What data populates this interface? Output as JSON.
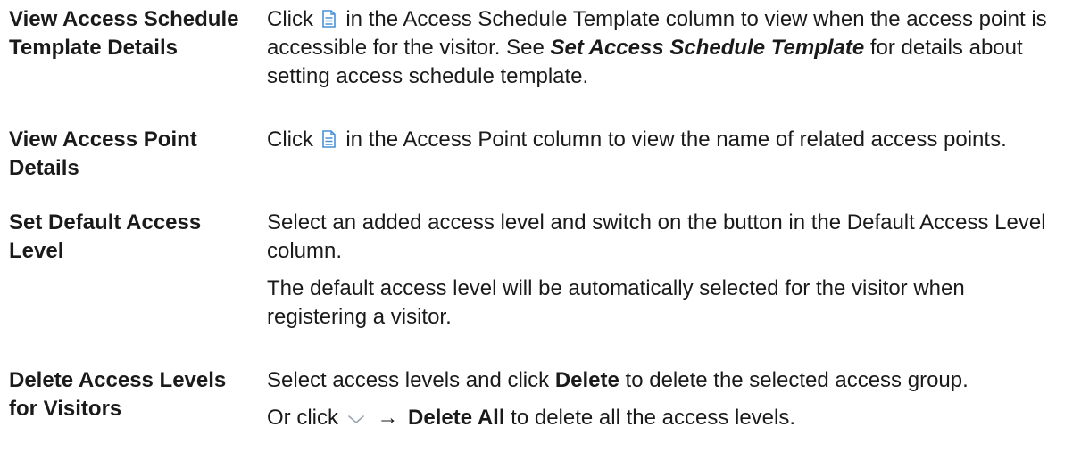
{
  "rows": [
    {
      "term": "View Access Schedule Template Details",
      "p1_before": "Click",
      "p1_after": "in the Access Schedule Template column to view when the access point is accessible for the visitor. See",
      "link": "Set Access Schedule Template",
      "p1_end": "for details about setting access schedule template.",
      "icon": "document-icon"
    },
    {
      "term": "View Access Point Details",
      "p1_before": "Click",
      "p1_after": "in the Access Point column to view the name of related access points.",
      "icon": "document-icon"
    },
    {
      "term": "Set Default Access Level",
      "p1": "Select an added access level and switch on the button in the Default Access Level column.",
      "p2": "The default access level will be automatically selected for the visitor when registering a visitor."
    },
    {
      "term": "Delete Access Levels for Visitors",
      "p1_before": "Select access levels and click",
      "p1_bold": "Delete",
      "p1_after": "to delete the selected access group.",
      "p2_before": "Or click",
      "p2_arrow": "→",
      "p2_bold": "Delete All",
      "p2_after": "to delete all the access levels.",
      "icons": [
        "chevron-down-icon"
      ]
    }
  ],
  "colors": {
    "text": "#1a1a1a",
    "icon_blue": "#4a90d9",
    "chevron_gray": "#9aa5b1"
  }
}
